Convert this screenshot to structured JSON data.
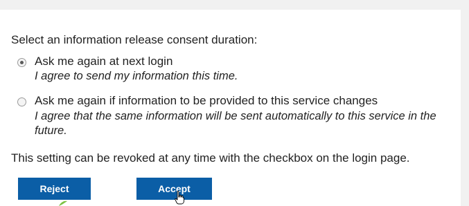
{
  "consent": {
    "heading": "Select an information release consent duration:",
    "options": [
      {
        "label": "Ask me again at next login",
        "description": "I agree to send my information this time.",
        "selected": true
      },
      {
        "label": "Ask me again if information to be provided to this service changes",
        "description": "I agree that the same information will be sent automatically to this service in the future.",
        "selected": false
      }
    ],
    "revoke_notice": "This setting can be revoked at any time with the checkbox on the login page."
  },
  "buttons": {
    "reject_label": "Reject",
    "accept_label": "Accept"
  },
  "colors": {
    "button_bg": "#0b5ea6",
    "button_text": "#ffffff",
    "background": "#ffffff"
  },
  "icons": {
    "cursor": "hand-pointer-icon"
  }
}
